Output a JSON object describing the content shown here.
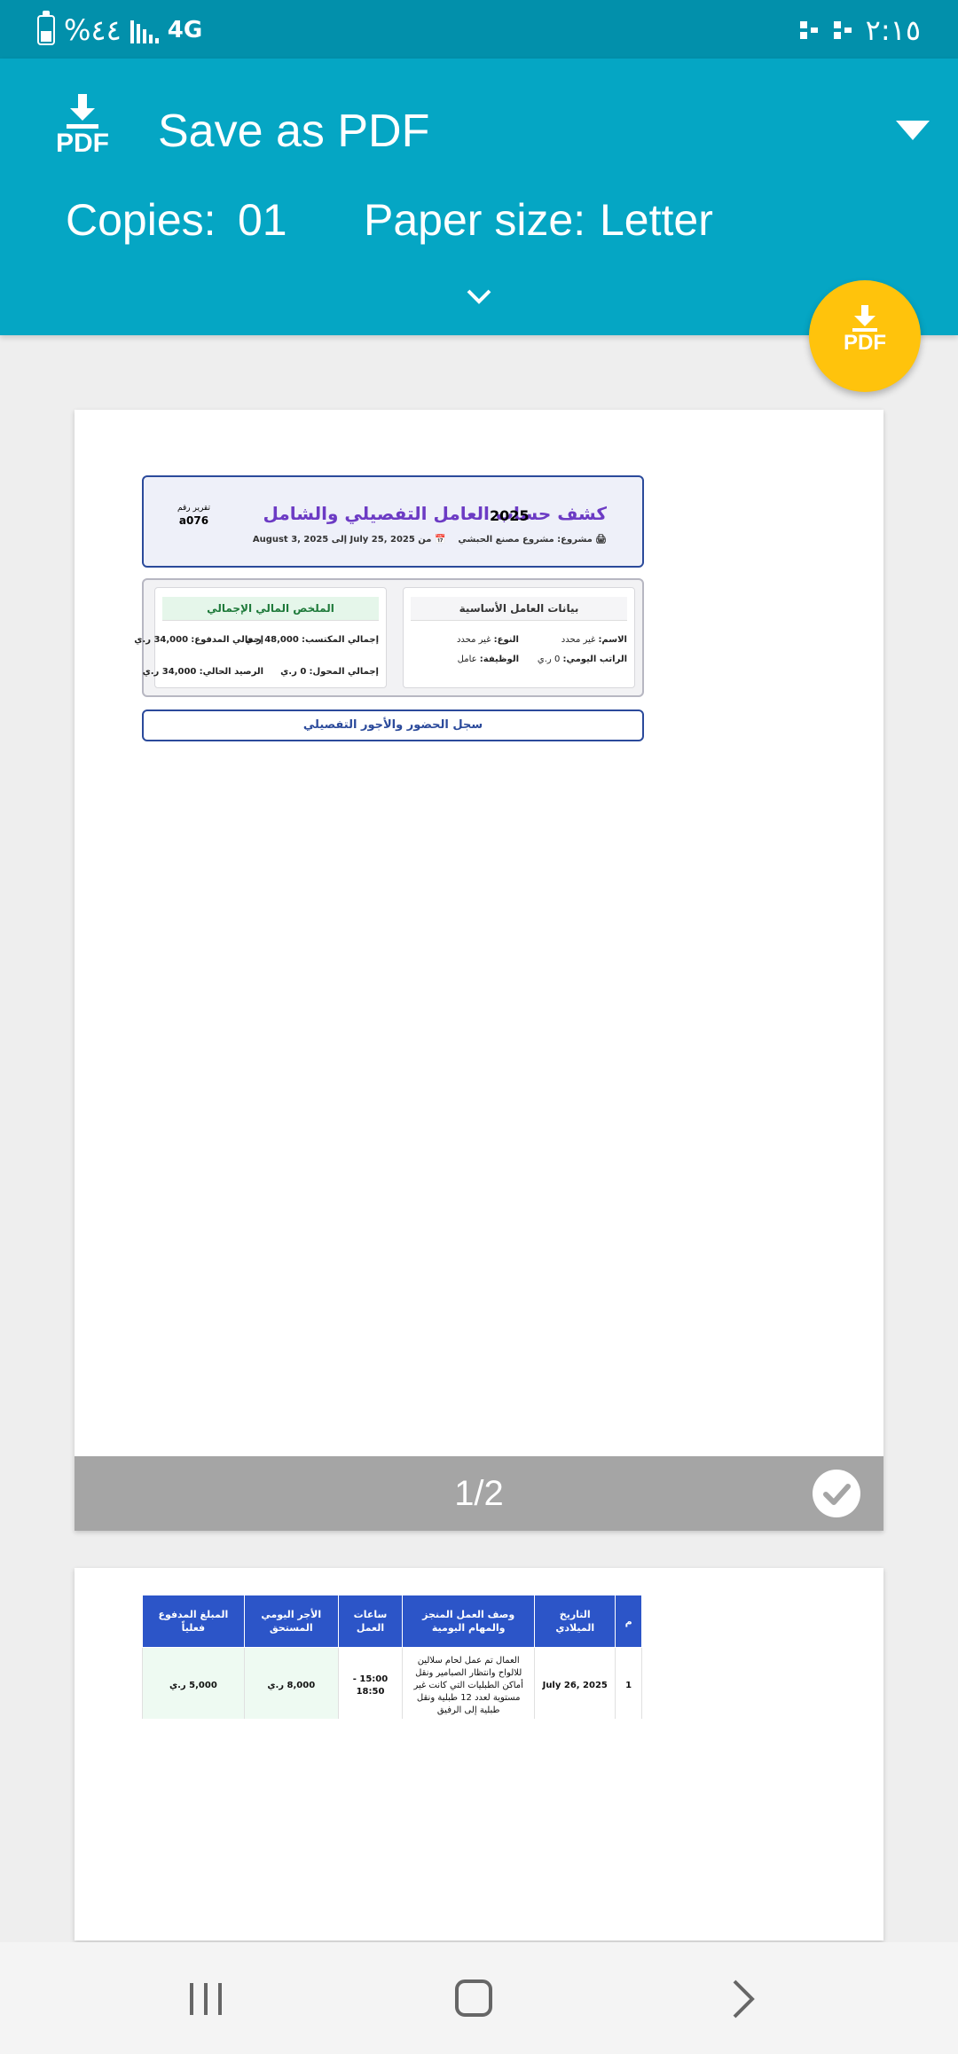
{
  "status_bar": {
    "battery_percent": "%٤٤",
    "network": "4G",
    "time": "٢:١٥"
  },
  "header": {
    "destination_title": "Save as PDF",
    "pdf_icon_label": "PDF",
    "copies_label": "Copies:",
    "copies_value": "01",
    "paper_size_label": "Paper size:",
    "paper_size_value": "Letter"
  },
  "fab": {
    "label": "PDF"
  },
  "page1": {
    "page_number": "1/2",
    "report": {
      "title": "كشف حساب العامل التفصيلي والشامل",
      "project": "مشروع: مشروع مصنع الحبشي",
      "period": "من July 25, 2025 إلى August 3, 2025",
      "year": "2025",
      "report_no_label": "تقرير رقم",
      "report_no_value": "a076",
      "worker_card": {
        "title": "بيانات العامل الأساسية",
        "name_label": "الاسم:",
        "name_value": "غير محدد",
        "type_label": "النوع:",
        "type_value": "غير محدد",
        "daily_label": "الراتب اليومي:",
        "daily_value": "0 ر.ي",
        "job_label": "الوظيفة:",
        "job_value": "عامل"
      },
      "finance_card": {
        "title": "الملخص المالي الإجمالي",
        "earned_label": "إجمالي المكتسب:",
        "earned_value": "48,000 ر.ي",
        "paid_label": "إجمالي المدفوع:",
        "paid_value": "34,000 ر.ي",
        "transferred_label": "إجمالي المحول:",
        "transferred_value": "0 ر.ي",
        "balance_label": "الرصيد الحالي:",
        "balance_value": "34,000 ر.ي"
      },
      "attendance_title": "سجل الحضور والأجور التفصيلي"
    }
  },
  "page2": {
    "columns": [
      "م",
      "التاريخ الميلادي",
      "وصف العمل المنجز والمهام اليومية",
      "ساعات العمل",
      "الأجر اليومي المستحق",
      "المبلغ المدفوع فعلياً"
    ],
    "rows": [
      {
        "index": "1",
        "date": "July 26, 2025",
        "description": "العمال تم عمل لحام سلالين للالواح وانتظار الصبامير ونقل أماكن الطبليات التي كانت غير مستوية لعدد 12 طبلية ونقل طبلية إلى الرفيق",
        "hours": "15:00 - 18:50",
        "wage": "8,000 ر.ي",
        "paid": "5,000 ر.ي"
      }
    ]
  },
  "colors": {
    "status_bar": "#0290ab",
    "header": "#05a6c4",
    "fab": "#ffc30c",
    "table_header": "#2c55c8",
    "report_title": "#6c3bc4"
  }
}
